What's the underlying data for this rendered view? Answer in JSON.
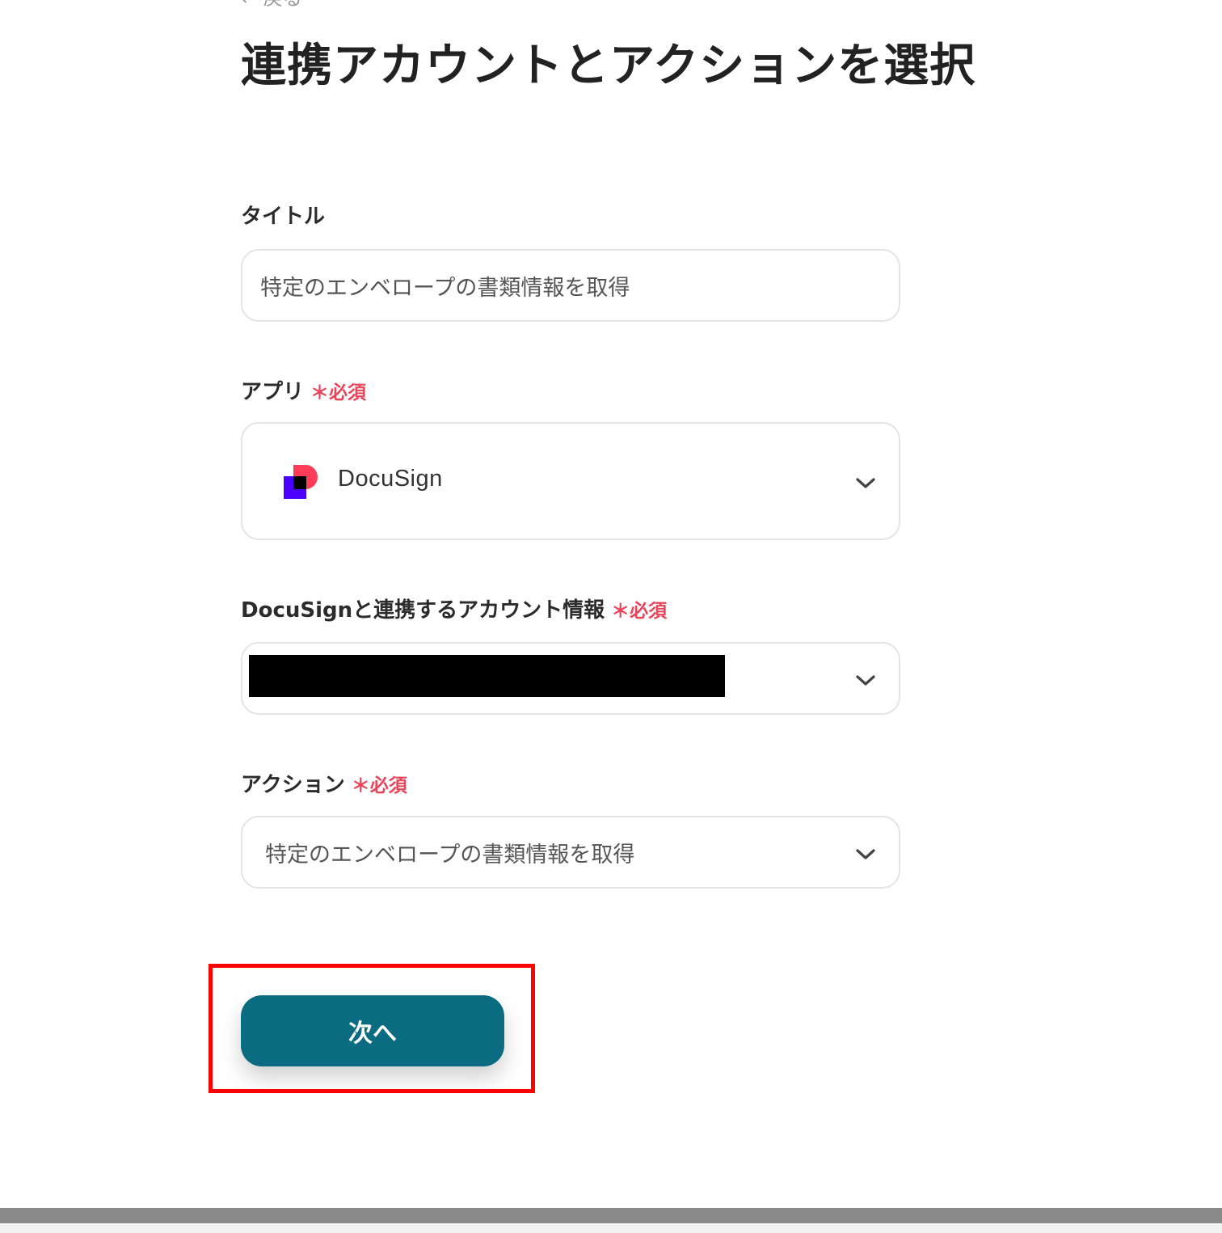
{
  "header": {
    "back_label": "← 戻る",
    "title": "連携アカウントとアクションを選択"
  },
  "form": {
    "title_field": {
      "label": "タイトル",
      "value": "特定のエンベロープの書類情報を取得"
    },
    "app_field": {
      "label": "アプリ",
      "required_label": "＊必須",
      "selected_app": "DocuSign",
      "logo_icon": "docusign-logo",
      "logo_colors": {
        "red": "#ff3c58",
        "purple": "#4c00ff",
        "black": "#000000"
      }
    },
    "account_field": {
      "label": "DocuSignと連携するアカウント情報",
      "required_label": "＊必須"
    },
    "action_field": {
      "label": "アクション",
      "required_label": "＊必須",
      "selected_action": "特定のエンベロープの書類情報を取得"
    }
  },
  "footer": {
    "next_label": "次へ"
  },
  "colors": {
    "primary_button": "#0b6b80",
    "required": "#e8445a",
    "highlight": "#ff0000"
  }
}
